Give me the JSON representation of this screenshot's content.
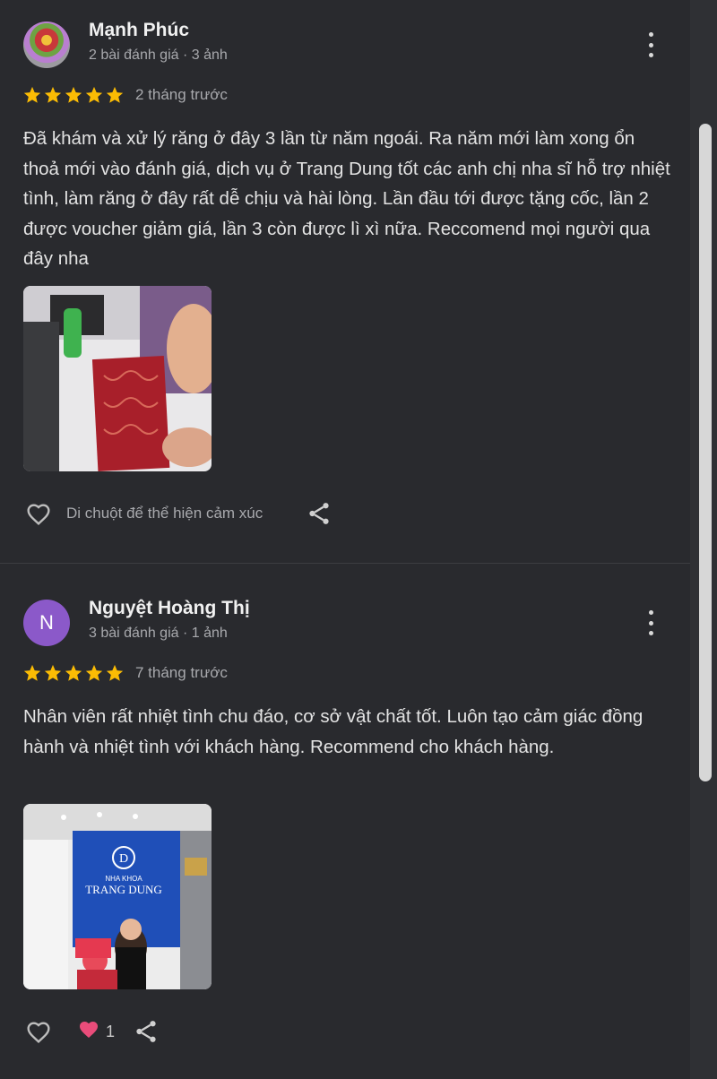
{
  "reviews": [
    {
      "name": "Mạnh Phúc",
      "meta": "2 bài đánh giá · 3 ảnh",
      "rating": 5,
      "time": "2 tháng trước",
      "text": "Đã khám và xử lý răng ở đây 3 lần từ năm ngoái. Ra năm mới làm xong ổn thoả mới vào đánh giá, dịch vụ ở Trang Dung tốt các anh chị nha sĩ hỗ trợ nhiệt tình, làm răng ở đây rất dễ chịu và hài lòng. Lần đầu tới được tặng cốc, lần 2 được voucher giảm giá, lần 3 còn được lì xì nữa. Reccomend mọi người qua đây nha",
      "reaction_label": "Di chuột để thể hiện cảm xúc"
    },
    {
      "name": "Nguyệt Hoàng Thị",
      "avatar_letter": "N",
      "meta": "3 bài đánh giá · 1 ảnh",
      "rating": 5,
      "time": "7 tháng trước",
      "text": "Nhân viên rất nhiệt tình chu đáo, cơ sở vật chất tốt. Luôn tạo cảm giác đồng hành và nhiệt tình với khách hàng. Recommend cho khách hàng.",
      "reaction_count": "1",
      "photo_sign": {
        "logo": "D",
        "line1": "NHA KHOA",
        "line2": "TRANG DUNG"
      }
    }
  ],
  "colors": {
    "background": "#292a2e",
    "star": "#fbbc04",
    "avatar_purple": "#8b59c9",
    "like_pink": "#e94c7a"
  }
}
